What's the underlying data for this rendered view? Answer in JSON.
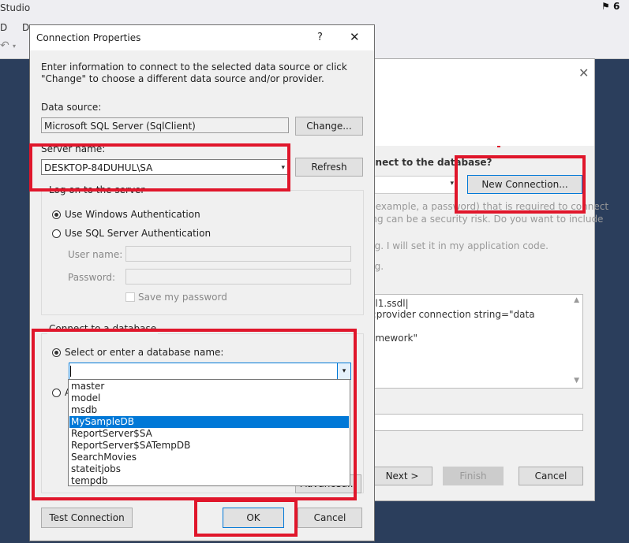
{
  "vs": {
    "title": "Studio",
    "menu": [
      "D",
      "D"
    ],
    "notification_count": "6"
  },
  "wizard": {
    "question": "nnect to the database?",
    "new_connection": "New Connection...",
    "sensitive_line1": "r example, a password) that is required to connect",
    "sensitive_line2": "ing can be a security risk. Do you want to include",
    "option_no": "ng. I will set it in my application code.",
    "option_yes": "ng.",
    "conn_line1": "el1.ssdl|",
    "conn_line2": "t;provider connection string=\"data",
    "conn_line3": "amework\"",
    "next": "Next >",
    "finish": "Finish",
    "cancel": "Cancel"
  },
  "dialog": {
    "title": "Connection Properties",
    "help": "?",
    "close": "✕",
    "intro": "Enter information to connect to the selected data source or click \"Change\" to choose a different data source and/or provider.",
    "data_source_label": "Data source:",
    "data_source_value": "Microsoft SQL Server (SqlClient)",
    "change": "Change...",
    "server_name_label": "Server name:",
    "server_name_value": "DESKTOP-84DUHUL\\SA",
    "refresh": "Refresh",
    "logon_group": "Log on to the server",
    "windows_auth": "Use Windows Authentication",
    "sql_auth": "Use SQL Server Authentication",
    "username_label": "User name:",
    "password_label": "Password:",
    "save_password": "Save my password",
    "db_group": "Connect to a database",
    "select_db": "Select or enter a database name:",
    "attach_db": "A",
    "db_input_value": "",
    "db_options": [
      "master",
      "model",
      "msdb",
      "MySampleDB",
      "ReportServer$SA",
      "ReportServer$SATempDB",
      "SearchMovies",
      "stateitjobs",
      "tempdb"
    ],
    "db_selected": "MySampleDB",
    "advanced": "Advanced...",
    "test_connection": "Test Connection",
    "ok": "OK",
    "cancel": "Cancel"
  },
  "colors": {
    "highlight": "#e0162b",
    "selection": "#0078d7",
    "vs_background": "#2b3e5c"
  }
}
